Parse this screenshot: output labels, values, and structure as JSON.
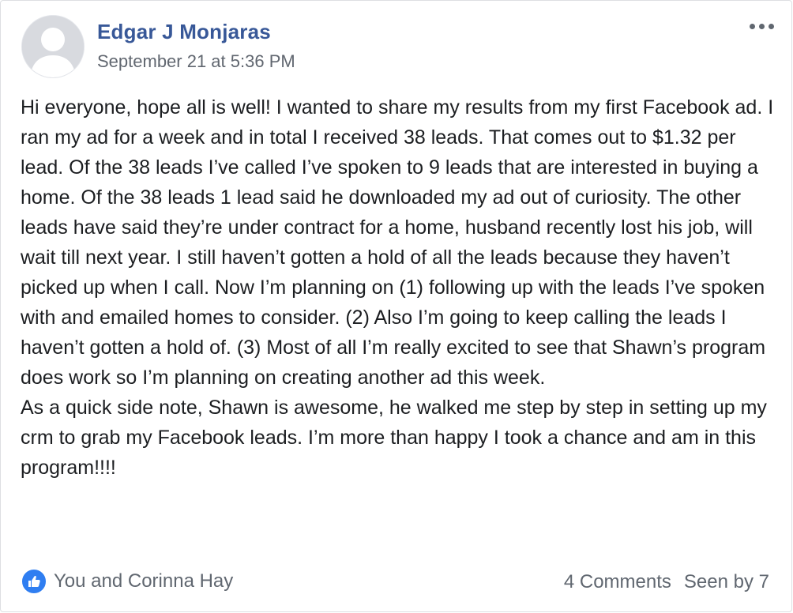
{
  "post": {
    "author": "Edgar J Monjaras",
    "timestamp": "September 21 at 5:36 PM",
    "paragraphs": [
      "Hi everyone, hope all is well! I wanted to share my results from my first Facebook ad. I ran my ad for a week and in total I received 38 leads. That comes out to $1.32 per lead. Of the 38 leads I’ve called I’ve spoken to 9 leads that are interested in buying a home. Of the 38 leads 1 lead said he downloaded my ad out of curiosity. The other leads have said they’re under contract for a home, husband recently lost his job, will wait till next year. I still haven’t gotten a hold of all the leads because they haven’t picked up when I call. Now I’m planning on (1) following up with the leads I’ve spoken with and emailed homes to consider. (2) Also I’m going to keep calling the leads I haven’t gotten a hold of. (3) Most of all I’m really excited to see that Shawn’s program does work so I’m planning on creating another ad this week.",
      "As a quick side note, Shawn is awesome, he walked me step by step in setting up my crm to grab my Facebook leads. I’m more than happy I took a chance and am in this program!!!!"
    ]
  },
  "footer": {
    "reactions_text": "You and Corinna Hay",
    "comments": "4 Comments",
    "seen_by": "Seen by 7"
  },
  "icons": {
    "avatar": "default-profile-silhouette-icon",
    "more": "more-options-icon",
    "like": "thumbs-up-icon"
  },
  "colors": {
    "author_link": "#385898",
    "secondary_text": "#616770",
    "like_blue": "#2f7ef1"
  }
}
